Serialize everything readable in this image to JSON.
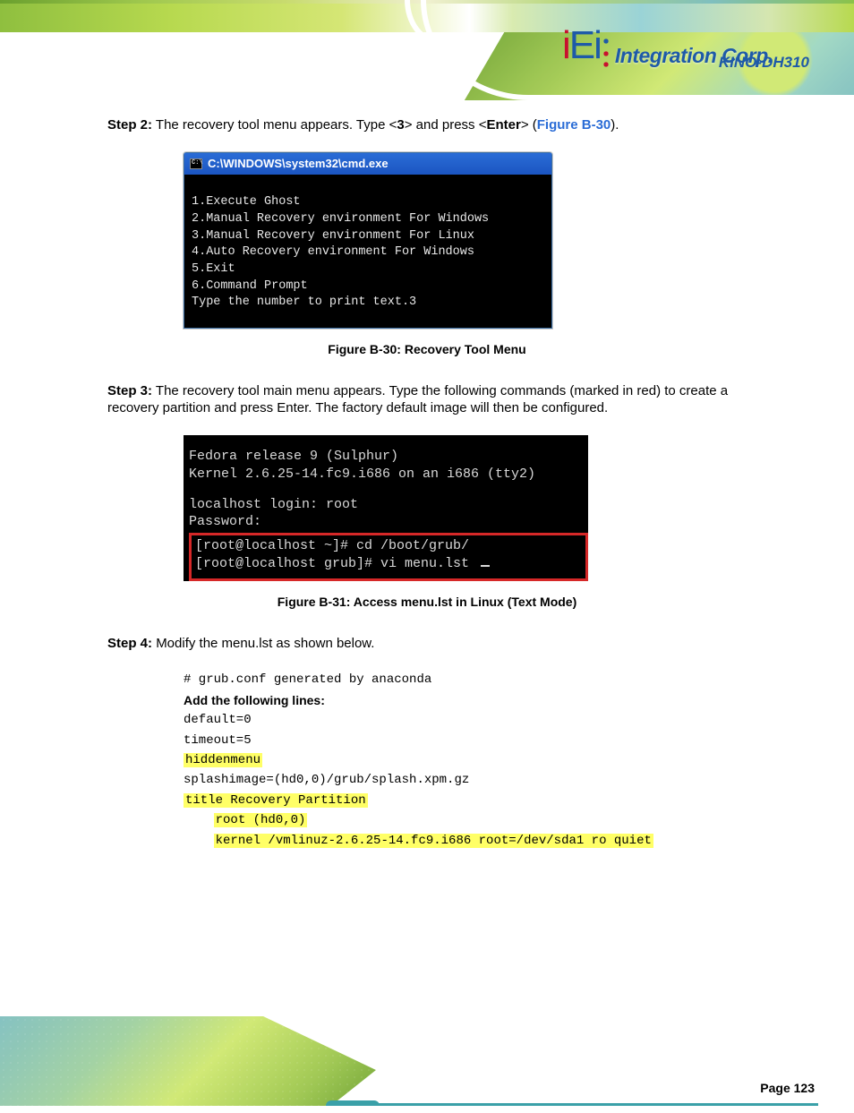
{
  "header": {
    "logo_i1": "i",
    "logo_e": "E",
    "logo_i2": "i",
    "logo_tag": "Integration Corp.",
    "product": "KINO-DH310"
  },
  "content": {
    "step2_lead": "Step 2:",
    "step2_body_a": "The recovery tool menu appears. Type <",
    "step2_bold": "3",
    "step2_body_b": "> and press <",
    "step2_bold2": "Enter",
    "step2_body_c": "> (",
    "step2_figref": "Figure B-30",
    "step2_body_d": ").",
    "cmd_title": "C:\\WINDOWS\\system32\\cmd.exe",
    "cmd_lines": "1.Execute Ghost\n2.Manual Recovery environment For Windows\n3.Manual Recovery environment For Linux\n4.Auto Recovery environment For Windows\n5.Exit\n6.Command Prompt\nType the number to print text.3",
    "fig1_caption": "Figure B-30: Recovery Tool Menu",
    "step3_lead": "Step 3:",
    "step3_body": "The recovery tool main menu appears. Type the following commands (marked in red) to create a recovery partition and press Enter. The factory default image will then be configured.",
    "term2_line1": "Fedora release 9 (Sulphur)",
    "term2_line2": "Kernel 2.6.25-14.fc9.i686 on an i686 (tty2)",
    "term2_line3": "localhost login: root",
    "term2_line4": "Password:",
    "term2_line5": "[root@localhost ~]# cd /boot/grub/",
    "term2_line6": "[root@localhost grub]# vi menu.lst",
    "fig2_caption": "Figure B-31: Access menu.lst in Linux (Text Mode)",
    "step4_lead": "Step 4:",
    "step4_body_a": "Modify the menu.lst as shown below.",
    "grub_heading": "# grub.conf generated by anaconda",
    "grub_note1": "Add the following lines:",
    "grub_l1": "default=0",
    "grub_l2": "timeout=5",
    "grub_hl1": "hiddenmenu",
    "grub_l3": "splashimage=(hd0,0)/grub/splash.xpm.gz",
    "grub_hl2a": "title Recovery Partition",
    "grub_hl2b": "root (hd0,0)",
    "grub_hl2c": "kernel /vmlinuz-2.6.25-14.fc9.i686 root=/dev/sda1 ro quiet"
  },
  "footer": {
    "page": "Page 123"
  }
}
